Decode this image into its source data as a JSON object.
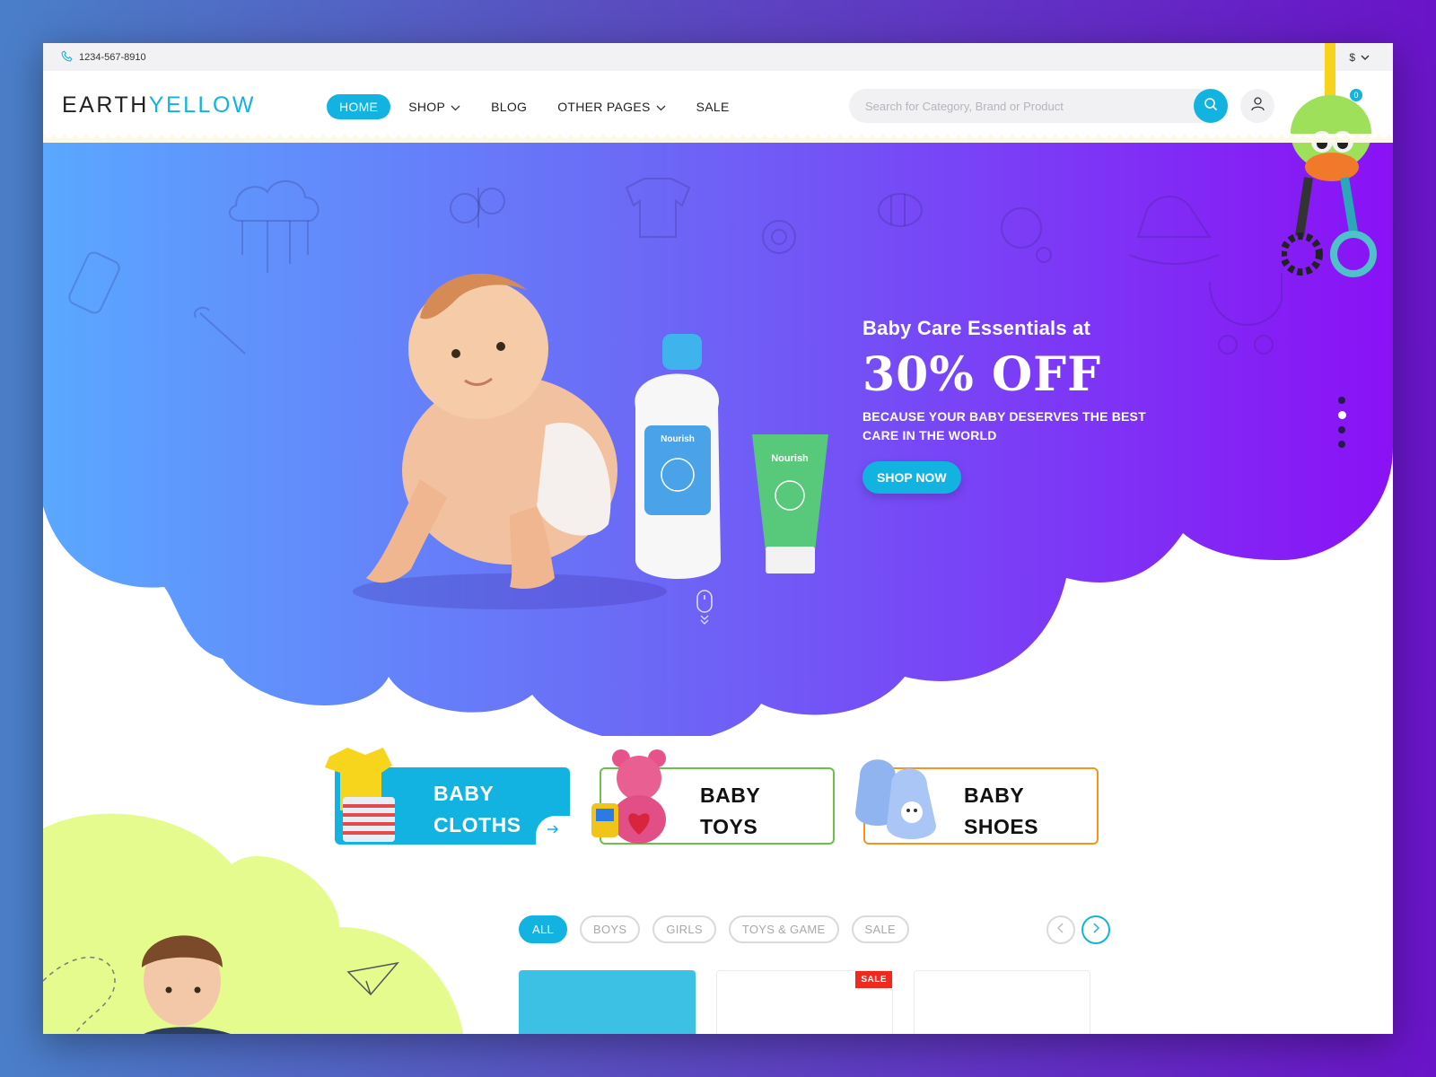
{
  "topbar": {
    "phone": "1234-567-8910",
    "currency": "$"
  },
  "header": {
    "logo_part1": "EARTH",
    "logo_part2": "YELLOW",
    "nav": [
      {
        "label": "HOME",
        "active": true
      },
      {
        "label": "SHOP",
        "dropdown": true
      },
      {
        "label": "BLOG"
      },
      {
        "label": "OTHER PAGES",
        "dropdown": true
      },
      {
        "label": "SALE"
      }
    ],
    "search_placeholder": "Search for Category, Brand or Product",
    "cart_count": "0"
  },
  "hero": {
    "eyebrow": "Baby Care Essentials at",
    "headline": "30% OFF",
    "subtitle": "BECAUSE YOUR BABY DESERVES THE BEST CARE IN THE WORLD",
    "cta": "SHOP NOW",
    "bottle_brand": "Nourish",
    "tube_brand": "Nourish",
    "slides_total": 4,
    "slide_active": 1
  },
  "categories": [
    {
      "line1": "BABY",
      "line2": "CLOTHS",
      "style": "filled"
    },
    {
      "line1": "BABY",
      "line2": "TOYS",
      "style": "outline-green"
    },
    {
      "line1": "BABY",
      "line2": "SHOES",
      "style": "outline-orange"
    }
  ],
  "filters": [
    "ALL",
    "BOYS",
    "GIRLS",
    "TOYS & GAME",
    "SALE"
  ],
  "active_filter": "ALL",
  "products": [
    {
      "sale": false
    },
    {
      "sale": true,
      "badge": "SALE"
    },
    {
      "sale": false
    }
  ],
  "colors": {
    "accent": "#12b3e0",
    "hero_left": "#5aa8ff",
    "hero_right": "#8a11f5",
    "green": "#6cc04a",
    "orange": "#f7941d",
    "lime": "#e6fb8e"
  }
}
